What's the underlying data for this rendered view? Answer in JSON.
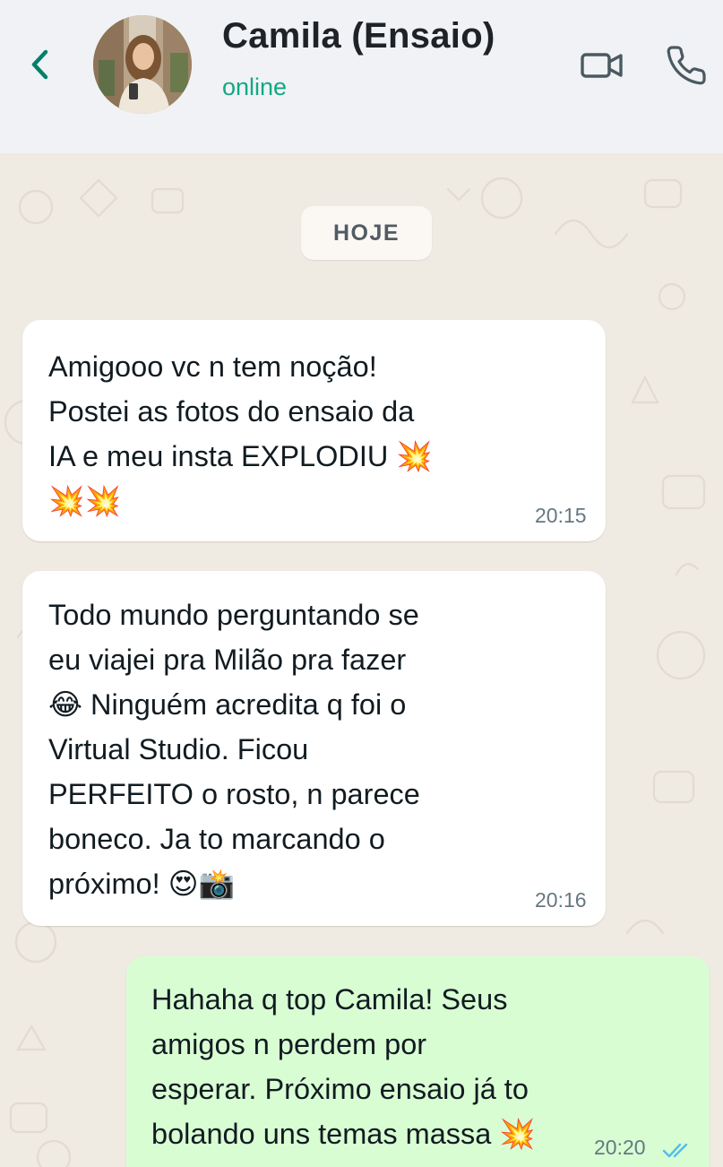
{
  "header": {
    "contact_name": "Camila (Ensaio)",
    "status": "online",
    "icons": [
      "back-chevron-icon",
      "video-call-icon",
      "voice-call-icon"
    ]
  },
  "chat": {
    "date_label": "HOJE",
    "messages": [
      {
        "direction": "incoming",
        "text": "Amigooo vc n tem noção!\nPostei as fotos do ensaio da\nIA e meu insta EXPLODIU 💥\n💥💥",
        "time": "20:15"
      },
      {
        "direction": "incoming",
        "text": "Todo mundo perguntando se\neu viajei pra Milão pra fazer\n😂 Ninguém acredita q foi o\nVirtual Studio. Ficou\nPERFEITO o rosto, n parece\nboneco. Ja to marcando o\npróximo! 😍📸",
        "time": "20:16"
      },
      {
        "direction": "outgoing",
        "text": "Hahaha q top Camila! Seus\namigos n perdem por\nesperar. Próximo ensaio já to\nbolando uns temas massa 💥",
        "time": "20:20",
        "status": "read"
      }
    ]
  },
  "colors": {
    "header_bg": "#f0f2f5",
    "accent": "#008069",
    "online": "#13a884",
    "chat_bg": "#efeae2",
    "incoming_bubble": "#ffffff",
    "outgoing_bubble": "#d9fdd3",
    "read_ticks": "#53bdeb"
  }
}
